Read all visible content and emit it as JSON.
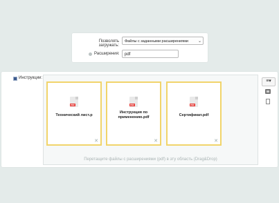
{
  "settings": {
    "allow_label": "Позволять загружать:",
    "allow_value": "Файлы с заданными расширениями",
    "extensions_label": "Расширения:",
    "extensions_value": "pdf"
  },
  "field": {
    "label": "Инструкции:"
  },
  "files": [
    {
      "name_line1": "Технический лист.р",
      "name_line2": ""
    },
    {
      "name_line1": "Инструкция по",
      "name_line2": "применению.pdf"
    },
    {
      "name_line1": "Сертификат.pdf",
      "name_line2": ""
    }
  ],
  "pdf_badge": "PDF",
  "close_glyph": "✕",
  "drop_hint": "Перетащите файлы с расширениями (pdf) в эту область (Drag&Drop)",
  "toolbar": {
    "menu_glyph": "≡▾"
  },
  "colors": {
    "card_border": "#f1d46a",
    "pdf_red": "#e53935",
    "background": "#e4ebea"
  }
}
